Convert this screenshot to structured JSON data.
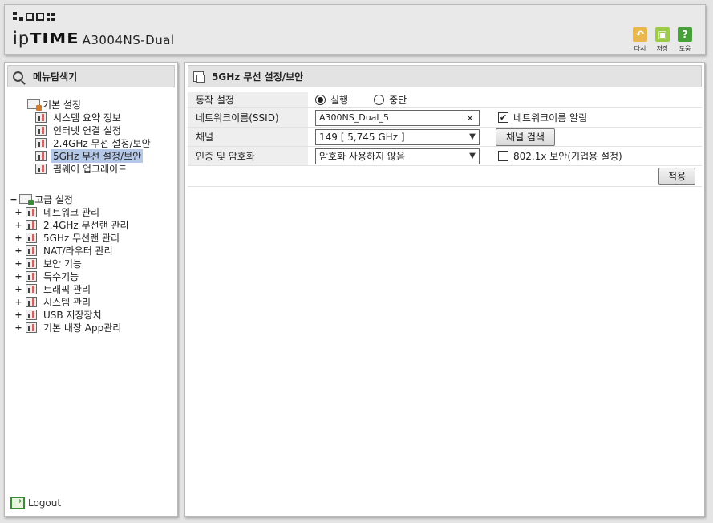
{
  "header": {
    "brand_ip": "ip",
    "brand_time": "TIME",
    "model": "A3004NS-Dual",
    "buttons": [
      {
        "label": "다시",
        "icon": "undo-icon",
        "color": "#e8b84d"
      },
      {
        "label": "저장",
        "icon": "save-icon",
        "color": "#9ccb45"
      },
      {
        "label": "도움",
        "icon": "help-icon",
        "color": "#48a03a"
      }
    ]
  },
  "sidebar": {
    "title": "메뉴탐색기",
    "basic": {
      "label": "기본 설정",
      "items": [
        {
          "label": "시스템 요약 정보"
        },
        {
          "label": "인터넷 연결 설정"
        },
        {
          "label": "2.4GHz 무선 설정/보안"
        },
        {
          "label": "5GHz 무선 설정/보안",
          "selected": true
        },
        {
          "label": "펌웨어 업그레이드"
        }
      ]
    },
    "advanced": {
      "label": "고급 설정",
      "toggle": "−",
      "items": [
        {
          "label": "네트워크 관리",
          "toggle": "+"
        },
        {
          "label": "2.4GHz 무선랜 관리",
          "toggle": "+"
        },
        {
          "label": "5GHz 무선랜 관리",
          "toggle": "+"
        },
        {
          "label": "NAT/라우터 관리",
          "toggle": "+"
        },
        {
          "label": "보안 기능",
          "toggle": "+"
        },
        {
          "label": "특수기능",
          "toggle": "+"
        },
        {
          "label": "트래픽 관리",
          "toggle": "+"
        },
        {
          "label": "시스템 관리",
          "toggle": "+"
        },
        {
          "label": "USB 저장장치",
          "toggle": "+"
        },
        {
          "label": "기본 내장 App관리",
          "toggle": "+"
        }
      ]
    },
    "logout": "Logout"
  },
  "main": {
    "title": "5GHz 무선 설정/보안",
    "rows": {
      "mode": {
        "label": "동작 설정",
        "options": [
          "실행",
          "중단"
        ],
        "selected": "실행"
      },
      "ssid": {
        "label": "네트워크이름(SSID)",
        "value": "A300NS_Dual_5",
        "clear": "×",
        "broadcast_label": "네트워크이름 알림",
        "broadcast_checked": true,
        "check_mark": "✔"
      },
      "channel": {
        "label": "채널",
        "value": "149 [ 5,745 GHz ]",
        "scan_button": "채널 검색"
      },
      "auth": {
        "label": "인증 및 암호화",
        "value": "암호화 사용하지 않음",
        "dot1x_label": "802.1x 보안(기업용 설정)",
        "dot1x_checked": false
      }
    },
    "apply_button": "적용"
  }
}
